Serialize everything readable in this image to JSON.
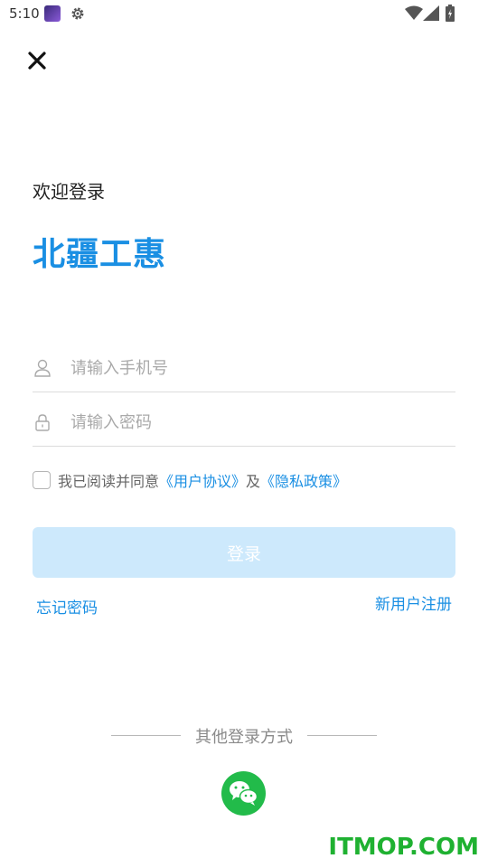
{
  "status_bar": {
    "time": "5:10"
  },
  "header": {
    "close_icon": "close-icon"
  },
  "welcome_text": "欢迎登录",
  "app_name": "北疆工惠",
  "form": {
    "phone_placeholder": "请输入手机号",
    "phone_value": "",
    "password_placeholder": "请输入密码",
    "password_value": ""
  },
  "agreement": {
    "checked": false,
    "prefix": "我已阅读并同意",
    "user_agreement": "《用户协议》",
    "conjunction": "及",
    "privacy_policy": "《隐私政策》"
  },
  "actions": {
    "login_label": "登录",
    "forgot_password": "忘记密码",
    "register": "新用户注册"
  },
  "other_login": {
    "label": "其他登录方式",
    "wechat_icon": "wechat-icon"
  },
  "watermark": "ITMOP.COM",
  "colors": {
    "brand_blue": "#1a8fe3",
    "login_button_disabled": "#cde9fc",
    "wechat_green": "#22bb4a",
    "watermark_green": "#1fb131"
  }
}
